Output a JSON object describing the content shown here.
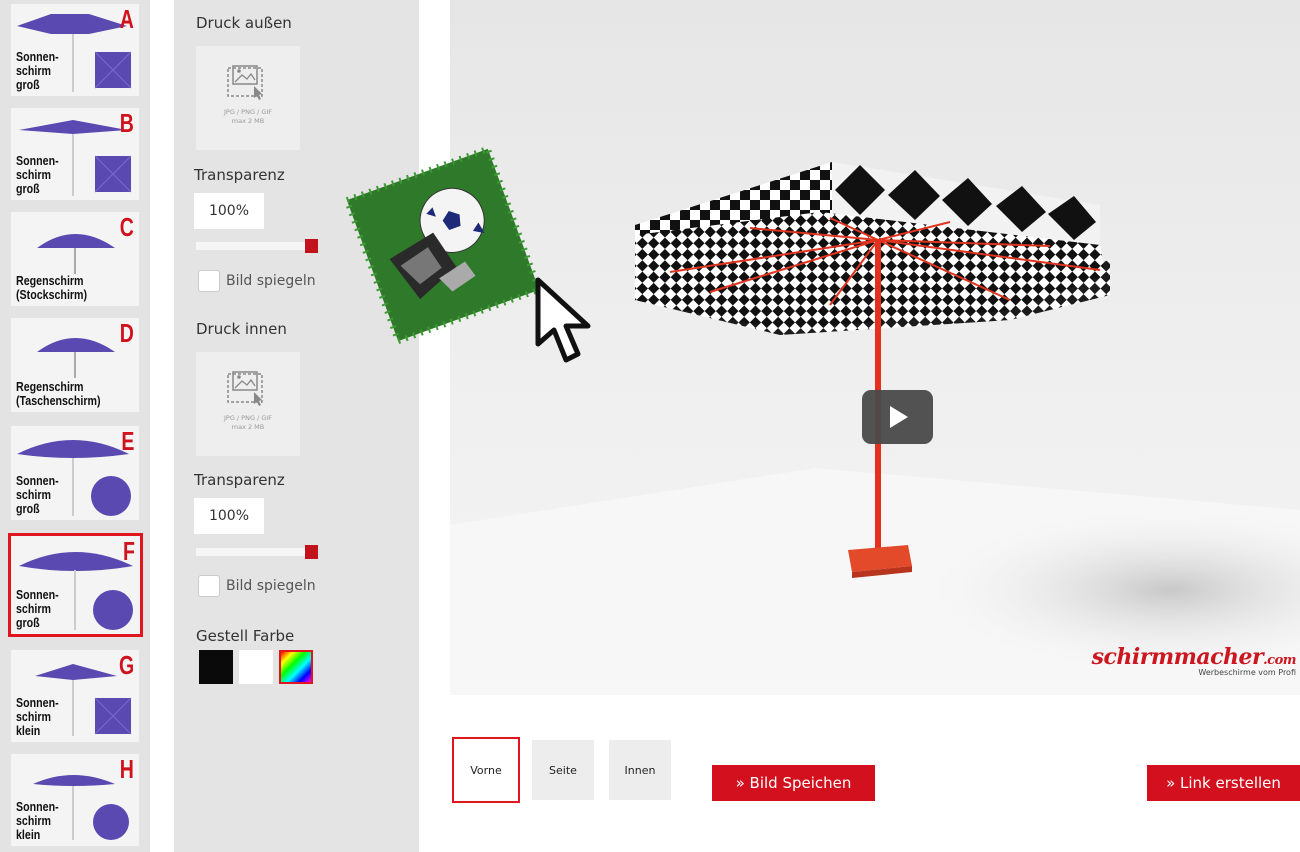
{
  "models": [
    {
      "letter": "A",
      "label": "Sonnen-\nschirm\ngroß",
      "kind": "square-big"
    },
    {
      "letter": "B",
      "label": "Sonnen-\nschirm\ngroß",
      "kind": "square-flat"
    },
    {
      "letter": "C",
      "label": "Regenschirm\n(Stockschirm)",
      "kind": "rain"
    },
    {
      "letter": "D",
      "label": "Regenschirm\n(Taschenschirm)",
      "kind": "rain"
    },
    {
      "letter": "E",
      "label": "Sonnen-\nschirm\ngroß",
      "kind": "round-big"
    },
    {
      "letter": "F",
      "label": "Sonnen-\nschirm\ngroß",
      "kind": "round-big"
    },
    {
      "letter": "G",
      "label": "Sonnen-\nschirm\nklein",
      "kind": "square-small"
    },
    {
      "letter": "H",
      "label": "Sonnen-\nschirm\nklein",
      "kind": "round-small"
    }
  ],
  "settings": {
    "outer": {
      "title": "Druck außen",
      "upload_hint": "JPG / PNG / GIF\nmax 2 MB",
      "transparency_label": "Transparenz",
      "transparency_value": "100%",
      "mirror_label": "Bild spiegeln"
    },
    "inner": {
      "title": "Druck innen",
      "upload_hint": "JPG / PNG / GIF\nmax 2 MB",
      "transparency_label": "Transparenz",
      "transparency_value": "100%",
      "mirror_label": "Bild spiegeln"
    },
    "frame_color_label": "Gestell Farbe",
    "colors": {
      "black": "#0a0a0a",
      "white": "#ffffff",
      "accent": "#e0151e"
    }
  },
  "viewport": {
    "logo_text": "schirmmacher",
    "logo_suffix": ".com",
    "logo_tagline": "Werbeschirme vom Profi"
  },
  "views": {
    "front": "Vorne",
    "side": "Seite",
    "inner": "Innen"
  },
  "actions": {
    "save_image": "» Bild Speichen",
    "create_link": "» Link erstellen"
  }
}
